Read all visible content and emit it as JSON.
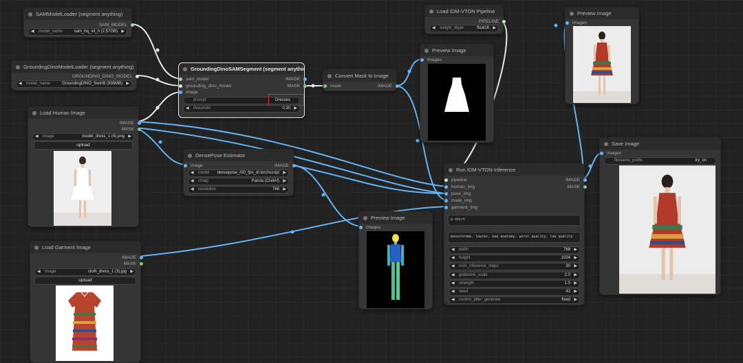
{
  "nodes": {
    "sam_loader": {
      "title": "SAMModelLoader (segment anything)",
      "output": "SAM_MODEL",
      "model_label": "model_name",
      "model_value": "sam_hq_vit_h (2.57GB)"
    },
    "gd_loader": {
      "title": "GroundingDinoModelLoader (segment anything)",
      "output": "GROUNDING_DINO_MODEL",
      "model_label": "model_name",
      "model_value": "GroundingDINO_SwinB (938MB)"
    },
    "load_human": {
      "title": "Load Human Image",
      "out_image": "IMAGE",
      "out_mask": "MASK",
      "image_label": "image",
      "image_value": "model_dress_1 (4).png",
      "upload": "upload"
    },
    "gd_sam": {
      "title": "GroundingDinoSAMSegment (segment anything)",
      "in_sam": "sam_model",
      "in_gd": "grounding_dino_model",
      "in_image": "image",
      "out_image": "IMAGE",
      "out_mask": "MASK",
      "prompt_label": "prompt",
      "prompt_value": "Dresses",
      "threshold_label": "threshold",
      "threshold_value": "0.30"
    },
    "convert_mask": {
      "title": "Convert Mask to Image",
      "in_mask": "mask",
      "out_image": "IMAGE"
    },
    "load_idm": {
      "title": "Load IDM-VTON Pipeline",
      "output": "PIPELINE",
      "dtype_label": "weight_dtype",
      "dtype_value": "float16"
    },
    "preview_mask": {
      "title": "Preview Image",
      "input": "images"
    },
    "preview_top": {
      "title": "Preview Image",
      "input": "images"
    },
    "densepose": {
      "title": "DensePose Estimator",
      "in_image": "image",
      "out_image": "IMAGE",
      "model_label": "model",
      "model_value": "densepose_r50_fpn_dl.torchscript",
      "cmap_label": "cmap",
      "cmap_value": "Parula (CivitAI)",
      "res_label": "resolution",
      "res_value": "768"
    },
    "run_idm": {
      "title": "Run IDM-VTON Inference",
      "inputs": [
        "pipeline",
        "human_img",
        "pose_img",
        "mask_img",
        "garment_img"
      ],
      "out_image": "IMAGE",
      "out_mask": "MASK",
      "prompt_text": "a shirt",
      "negative_text": "monochrome, lowres, bad anatomy, worst quality, low quality",
      "widgets": [
        {
          "label": "width",
          "value": "768"
        },
        {
          "label": "height",
          "value": "1024"
        },
        {
          "label": "num_inference_steps",
          "value": "30"
        },
        {
          "label": "guidance_scale",
          "value": "2.0"
        },
        {
          "label": "strength",
          "value": "1.0"
        },
        {
          "label": "seed",
          "value": "42"
        },
        {
          "label": "control_after_generate",
          "value": "fixed"
        }
      ]
    },
    "save_image": {
      "title": "Save Image",
      "input": "images",
      "prefix_label": "filename_prefix",
      "prefix_value": "try_on"
    },
    "preview_pose": {
      "title": "Preview Image",
      "input": "images"
    },
    "load_garment": {
      "title": "Load Garment Image",
      "out_image": "IMAGE",
      "out_mask": "MASK",
      "image_label": "image",
      "image_value": "cloth_dress_1 (3).jpg",
      "upload": "upload"
    }
  },
  "colors": {
    "canvas": "#222222",
    "node": "#353535",
    "image_wire": "#64b5f6",
    "mask_wire": "#81c784",
    "generic_wire": "#e0e0e0",
    "highlight": "#d32f2f"
  },
  "icons": [
    "arrow-left-icon",
    "arrow-right-icon"
  ]
}
